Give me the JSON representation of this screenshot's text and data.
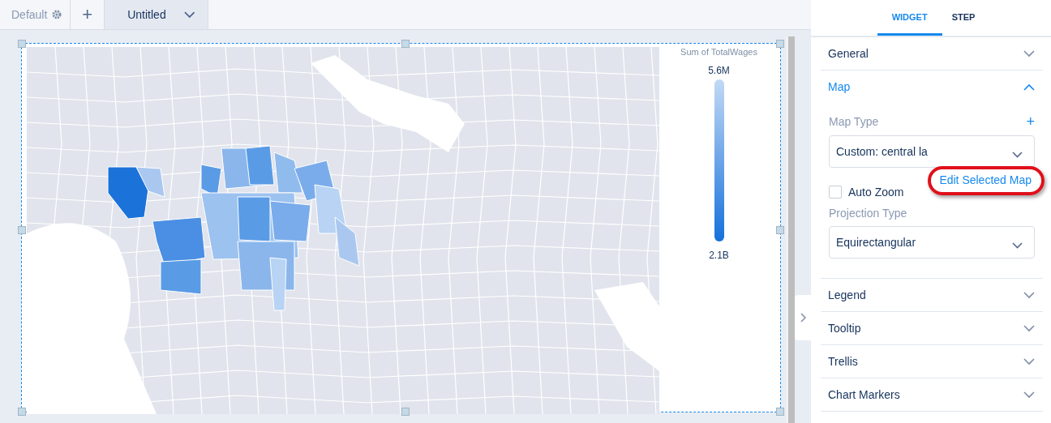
{
  "canvas_tabs": [
    {
      "label": "Default",
      "kind": "settings",
      "selected": false
    },
    {
      "label": "+",
      "kind": "add",
      "selected": false
    },
    {
      "label": "Untitled",
      "kind": "menu",
      "selected": true
    }
  ],
  "legend": {
    "title": "Sum of TotalWages",
    "max": "5.6M",
    "min": "2.1B"
  },
  "panel": {
    "tabs": [
      {
        "label": "WIDGET",
        "selected": true
      },
      {
        "label": "STEP",
        "selected": false
      }
    ],
    "sections": [
      {
        "title": "General",
        "expanded": false
      },
      {
        "title": "Map",
        "expanded": true,
        "map_type": {
          "label": "Map Type",
          "add": "+",
          "value": "Custom: central la"
        },
        "edit_link": "Edit Selected Map",
        "auto_zoom": {
          "label": "Auto Zoom",
          "checked": false
        },
        "projection": {
          "label": "Projection Type",
          "value": "Equirectangular"
        }
      },
      {
        "title": "Legend",
        "expanded": false
      },
      {
        "title": "Tooltip",
        "expanded": false
      },
      {
        "title": "Trellis",
        "expanded": false
      },
      {
        "title": "Chart Markers",
        "expanded": false
      }
    ]
  }
}
